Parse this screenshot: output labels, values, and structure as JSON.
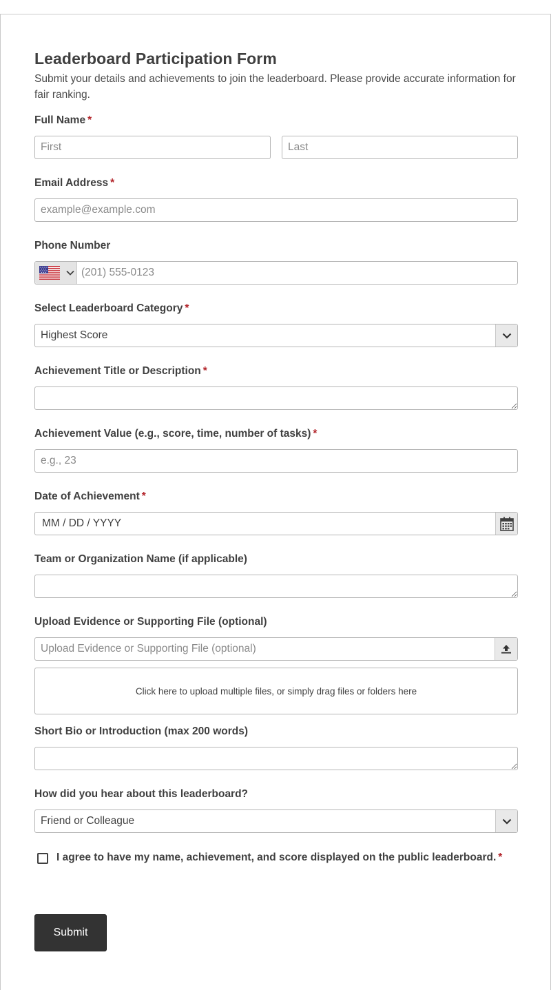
{
  "form": {
    "title": "Leaderboard Participation Form",
    "subtitle": "Submit your details and achievements to join the leaderboard. Please provide accurate information for fair ranking.",
    "required_marker": "*"
  },
  "full_name": {
    "label": "Full Name",
    "first_placeholder": "First",
    "last_placeholder": "Last"
  },
  "email": {
    "label": "Email Address",
    "placeholder": "example@example.com"
  },
  "phone": {
    "label": "Phone Number",
    "country_icon": "us-flag-icon",
    "placeholder": "(201) 555-0123"
  },
  "category": {
    "label": "Select Leaderboard Category",
    "selected": "Highest Score"
  },
  "achievement_title": {
    "label": "Achievement Title or Description",
    "value": ""
  },
  "achievement_value": {
    "label": "Achievement Value (e.g., score, time, number of tasks)",
    "placeholder": "e.g., 23"
  },
  "date": {
    "label": "Date of Achievement",
    "placeholder": "MM / DD / YYYY",
    "icon": "calendar-icon"
  },
  "team": {
    "label": "Team or Organization Name (if applicable)",
    "value": ""
  },
  "upload": {
    "label": "Upload Evidence or Supporting File (optional)",
    "placeholder": "Upload Evidence or Supporting File (optional)",
    "icon": "upload-icon",
    "dropzone_text": "Click here to upload multiple files, or simply drag files or folders here"
  },
  "bio": {
    "label": "Short Bio or Introduction (max 200 words)",
    "value": ""
  },
  "referral": {
    "label": "How did you hear about this leaderboard?",
    "selected": "Friend or Colleague"
  },
  "consent": {
    "label": "I agree to have my name, achievement, and score displayed on the public leaderboard."
  },
  "submit": {
    "label": "Submit"
  },
  "colors": {
    "required": "#b3262c",
    "button_bg": "#333333",
    "border": "#b5b5b5"
  }
}
